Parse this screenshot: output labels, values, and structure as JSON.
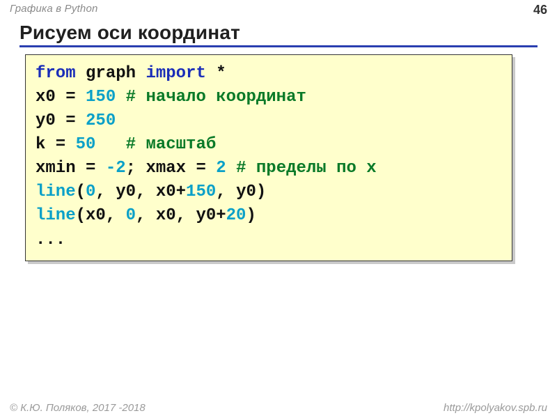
{
  "topbar": {
    "title": "Графика в Python",
    "page": "46"
  },
  "heading": "Рисуем оси координат",
  "code": {
    "tokens": [
      [
        {
          "t": "from",
          "c": "kw"
        },
        {
          "t": " graph "
        },
        {
          "t": "import",
          "c": "kw"
        },
        {
          "t": " *"
        }
      ],
      [
        {
          "t": "x0 = "
        },
        {
          "t": "150",
          "c": "num"
        },
        {
          "t": " "
        },
        {
          "t": "# начало координат",
          "c": "cmt"
        }
      ],
      [
        {
          "t": "y0 = "
        },
        {
          "t": "250",
          "c": "num"
        }
      ],
      [
        {
          "t": "k = "
        },
        {
          "t": "50",
          "c": "num"
        },
        {
          "t": "   "
        },
        {
          "t": "# масштаб",
          "c": "cmt"
        }
      ],
      [
        {
          "t": "xmin = "
        },
        {
          "t": "-2",
          "c": "num"
        },
        {
          "t": "; xmax = "
        },
        {
          "t": "2",
          "c": "num"
        },
        {
          "t": " "
        },
        {
          "t": "# пределы по x",
          "c": "cmt"
        }
      ],
      [
        {
          "t": "line",
          "c": "fn"
        },
        {
          "t": "("
        },
        {
          "t": "0",
          "c": "num"
        },
        {
          "t": ", y0, x0+"
        },
        {
          "t": "150",
          "c": "num"
        },
        {
          "t": ", y0)"
        }
      ],
      [
        {
          "t": "line",
          "c": "fn"
        },
        {
          "t": "(x0, "
        },
        {
          "t": "0",
          "c": "num"
        },
        {
          "t": ", x0, y0+"
        },
        {
          "t": "20",
          "c": "num"
        },
        {
          "t": ")"
        }
      ],
      [
        {
          "t": "..."
        }
      ]
    ]
  },
  "footer": {
    "copyright": "© К.Ю. Поляков, 2017 -2018",
    "url": "http://kpolyakov.spb.ru"
  }
}
